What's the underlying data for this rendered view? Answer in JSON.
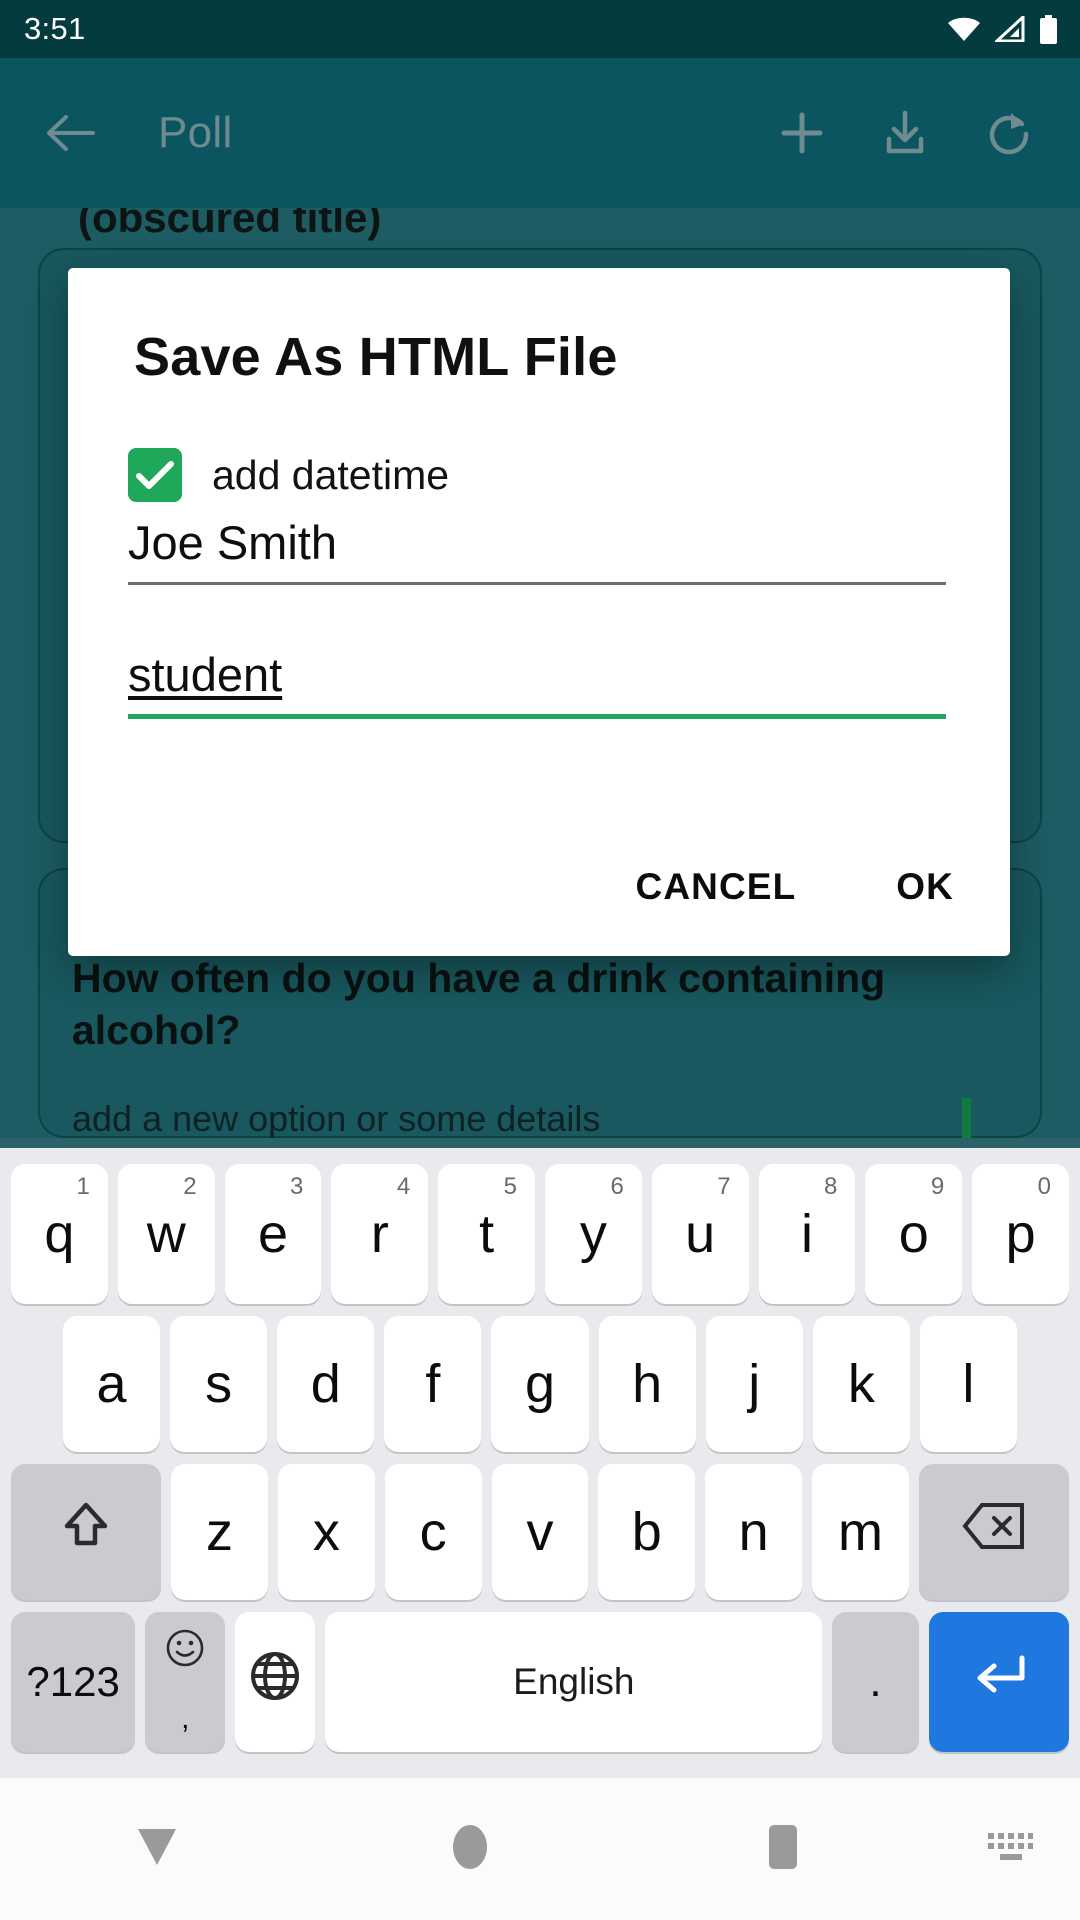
{
  "status_bar": {
    "time": "3:51",
    "icons": [
      "wifi-icon",
      "cellular-signal-icon",
      "battery-icon"
    ]
  },
  "app_bar": {
    "back_icon": "back-arrow-icon",
    "title": "Poll",
    "actions": [
      {
        "name": "add-icon",
        "label": "+"
      },
      {
        "name": "download-icon",
        "label": ""
      },
      {
        "name": "refresh-icon",
        "label": ""
      }
    ]
  },
  "background": {
    "card_title": "(obscured title)",
    "question": "How often do you have a drink containing alcohol?",
    "hint": "add a new option or some details"
  },
  "dialog": {
    "title": "Save As HTML File",
    "checkbox": {
      "label": "add datetime",
      "checked": true,
      "color": "#1fa85a"
    },
    "fields": [
      {
        "name": "author-field",
        "value": "Joe Smith",
        "focused": false
      },
      {
        "name": "role-field",
        "value": "student",
        "focused": true
      }
    ],
    "buttons": {
      "cancel": "CANCEL",
      "ok": "OK"
    }
  },
  "keyboard": {
    "row1": [
      {
        "key": "q",
        "num": "1"
      },
      {
        "key": "w",
        "num": "2"
      },
      {
        "key": "e",
        "num": "3"
      },
      {
        "key": "r",
        "num": "4"
      },
      {
        "key": "t",
        "num": "5"
      },
      {
        "key": "y",
        "num": "6"
      },
      {
        "key": "u",
        "num": "7"
      },
      {
        "key": "i",
        "num": "8"
      },
      {
        "key": "o",
        "num": "9"
      },
      {
        "key": "p",
        "num": "0"
      }
    ],
    "row2": [
      "a",
      "s",
      "d",
      "f",
      "g",
      "h",
      "j",
      "k",
      "l"
    ],
    "row3": [
      "z",
      "x",
      "c",
      "v",
      "b",
      "n",
      "m"
    ],
    "shift_icon": "shift-arrow-icon",
    "backspace_icon": "backspace-icon",
    "row4": {
      "symbols": "?123",
      "emoji_icon": "emoji-icon",
      "comma": ",",
      "globe_icon": "globe-icon",
      "space_label": "English",
      "period": ".",
      "enter_icon": "enter-arrow-icon"
    }
  },
  "nav_bar": {
    "back": "back-triangle-icon",
    "home": "home-circle-icon",
    "recents": "recents-square-icon",
    "keyboard": "keyboard-switch-icon"
  },
  "colors": {
    "status_bar": "#043b3e",
    "app_bar": "#0b5560",
    "scrim": "#1c5c62",
    "accent_green": "#1fa85a",
    "enter_blue": "#1f77e0"
  }
}
